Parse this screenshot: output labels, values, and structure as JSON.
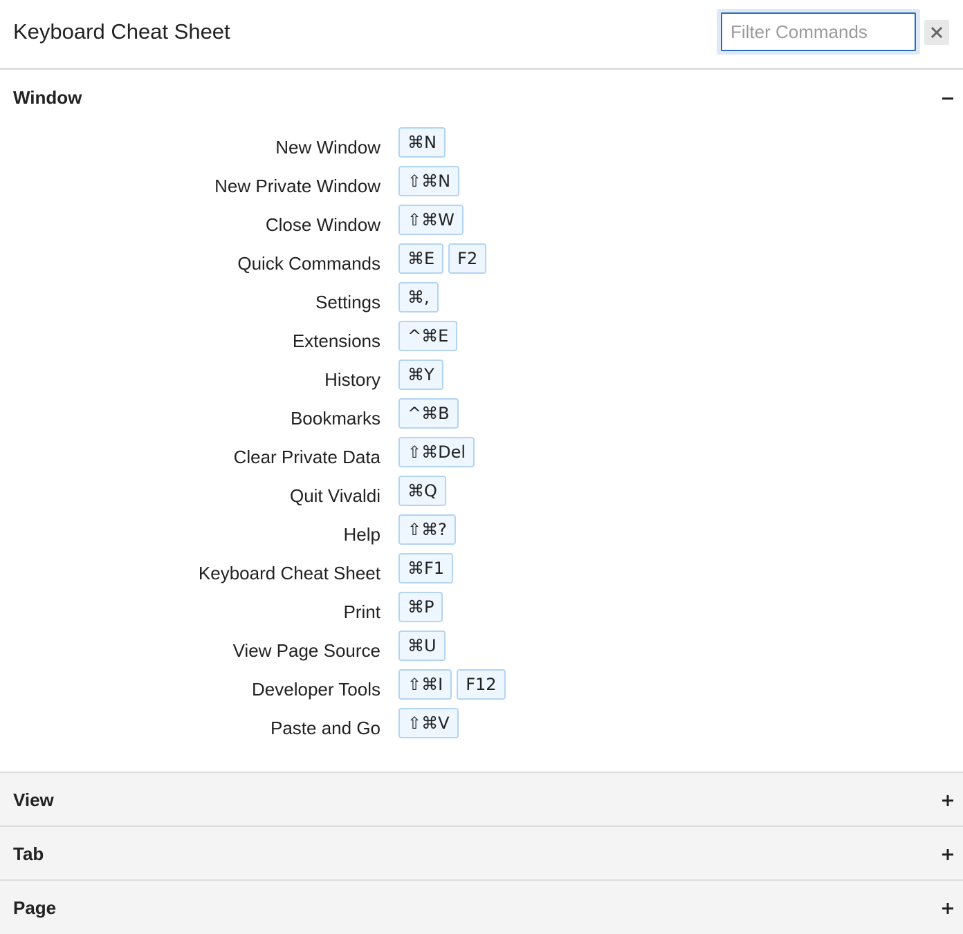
{
  "header": {
    "title": "Keyboard Cheat Sheet",
    "filter_placeholder": "Filter Commands",
    "filter_value": ""
  },
  "sections": {
    "window": {
      "title": "Window",
      "expanded": true,
      "commands": [
        {
          "name": "New Window",
          "keys": [
            "⌘N"
          ]
        },
        {
          "name": "New Private Window",
          "keys": [
            "⇧⌘N"
          ]
        },
        {
          "name": "Close Window",
          "keys": [
            "⇧⌘W"
          ]
        },
        {
          "name": "Quick Commands",
          "keys": [
            "⌘E",
            "F2"
          ]
        },
        {
          "name": "Settings",
          "keys": [
            "⌘,"
          ]
        },
        {
          "name": "Extensions",
          "keys": [
            "^⌘E"
          ]
        },
        {
          "name": "History",
          "keys": [
            "⌘Y"
          ]
        },
        {
          "name": "Bookmarks",
          "keys": [
            "^⌘B"
          ]
        },
        {
          "name": "Clear Private Data",
          "keys": [
            "⇧⌘Del"
          ]
        },
        {
          "name": "Quit Vivaldi",
          "keys": [
            "⌘Q"
          ]
        },
        {
          "name": "Help",
          "keys": [
            "⇧⌘?"
          ]
        },
        {
          "name": "Keyboard Cheat Sheet",
          "keys": [
            "⌘F1"
          ]
        },
        {
          "name": "Print",
          "keys": [
            "⌘P"
          ]
        },
        {
          "name": "View Page Source",
          "keys": [
            "⌘U"
          ]
        },
        {
          "name": "Developer Tools",
          "keys": [
            "⇧⌘I",
            "F12"
          ]
        },
        {
          "name": "Paste and Go",
          "keys": [
            "⇧⌘V"
          ]
        }
      ]
    },
    "view": {
      "title": "View",
      "expanded": false
    },
    "tab": {
      "title": "Tab",
      "expanded": false
    },
    "page": {
      "title": "Page",
      "expanded": false
    }
  },
  "colors": {
    "key_background": "#eef6ff",
    "key_border": "#b3d4f2",
    "input_focus_border": "#2a6cc4",
    "collapsed_section_background": "#f4f4f4"
  }
}
